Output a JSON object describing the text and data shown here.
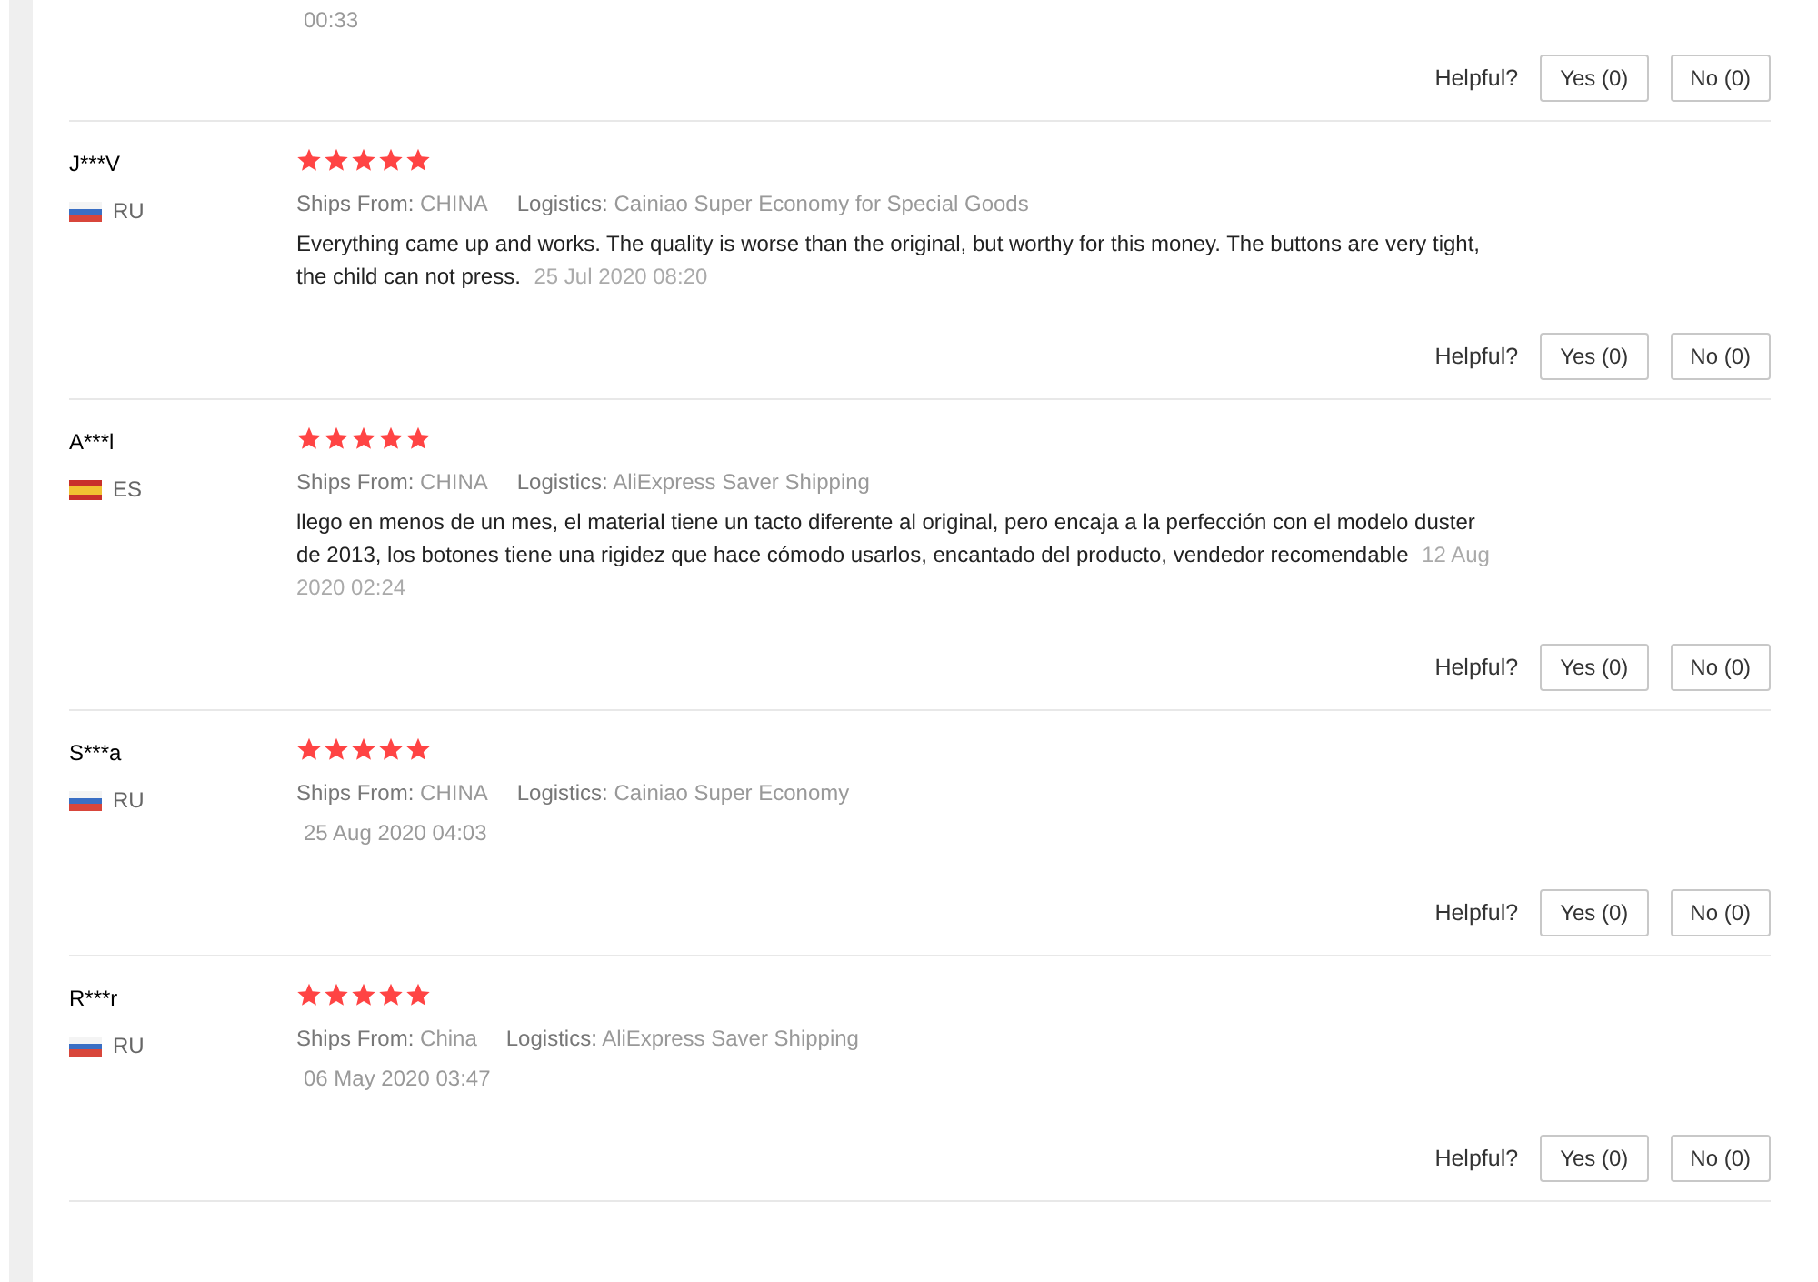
{
  "top_fragment": {
    "date": "00:33",
    "helpful": {
      "label": "Helpful?",
      "yes": "Yes (0)",
      "no": "No (0)"
    }
  },
  "reviews": [
    {
      "name": "J***V",
      "country": "RU",
      "kind": "ru",
      "stars": 5,
      "ships_label": "Ships From:",
      "ships_from": "CHINA",
      "logistics_label": "Logistics:",
      "logistics": "Cainiao Super Economy for Special Goods",
      "text": "Everything came up and works. The quality is worse than the original, but worthy for this money. The buttons are very tight, the child can not press.",
      "date": "25 Jul 2020 08:20",
      "helpful": {
        "label": "Helpful?",
        "yes": "Yes (0)",
        "no": "No (0)"
      }
    },
    {
      "name": "A***l",
      "country": "ES",
      "kind": "es",
      "stars": 5,
      "ships_label": "Ships From:",
      "ships_from": "CHINA",
      "logistics_label": "Logistics:",
      "logistics": "AliExpress Saver Shipping",
      "text": "llego en menos de un mes, el material tiene un tacto diferente al original, pero encaja a la perfección con el modelo duster de 2013, los botones tiene una rigidez que hace cómodo usarlos, encantado del producto, vendedor recomendable",
      "date": "12 Aug 2020 02:24",
      "helpful": {
        "label": "Helpful?",
        "yes": "Yes (0)",
        "no": "No (0)"
      }
    },
    {
      "name": "S***a",
      "country": "RU",
      "kind": "ru",
      "stars": 5,
      "ships_label": "Ships From:",
      "ships_from": "CHINA",
      "logistics_label": "Logistics:",
      "logistics": "Cainiao Super Economy",
      "date": "25 Aug 2020 04:03",
      "helpful": {
        "label": "Helpful?",
        "yes": "Yes (0)",
        "no": "No (0)"
      }
    },
    {
      "name": "R***r",
      "country": "RU",
      "kind": "ru",
      "stars": 5,
      "ships_label": "Ships From:",
      "ships_from": "China",
      "logistics_label": "Logistics:",
      "logistics": "AliExpress Saver Shipping",
      "date": "06 May 2020 03:47",
      "helpful": {
        "label": "Helpful?",
        "yes": "Yes (0)",
        "no": "No (0)"
      }
    }
  ]
}
